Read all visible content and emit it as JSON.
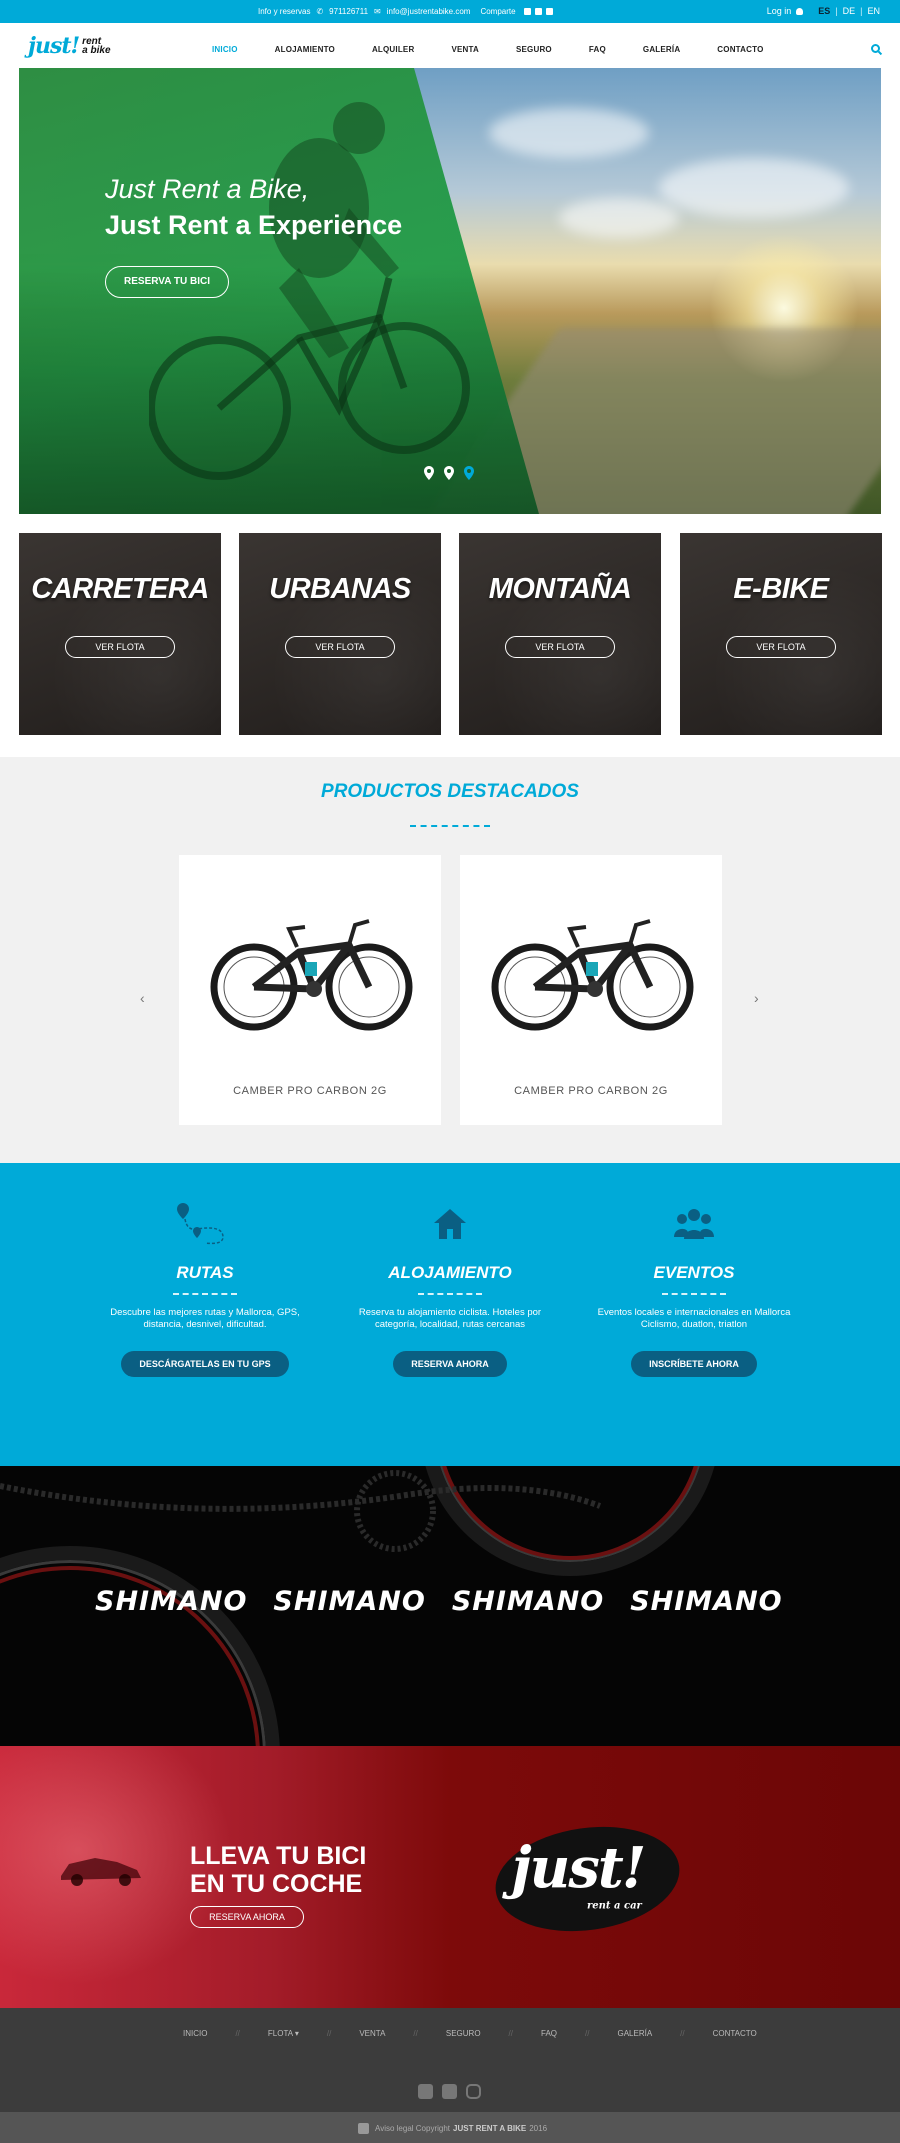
{
  "topbar": {
    "info_label": "Info y reservas",
    "phone": "971126711",
    "email": "info@justrentabike.com",
    "share_label": "Comparte",
    "login": "Log in",
    "languages": [
      "ES",
      "DE",
      "EN"
    ],
    "active_language": "ES"
  },
  "header": {
    "logo_just": "just!",
    "logo_line1": "rent",
    "logo_line2": "a bike",
    "nav": [
      {
        "label": "INICIO",
        "active": true
      },
      {
        "label": "ALOJAMIENTO",
        "active": false
      },
      {
        "label": "ALQUILER",
        "active": false
      },
      {
        "label": "VENTA",
        "active": false
      },
      {
        "label": "SEGURO",
        "active": false
      },
      {
        "label": "FAQ",
        "active": false
      },
      {
        "label": "GALERÍA",
        "active": false
      },
      {
        "label": "CONTACTO",
        "active": false
      }
    ]
  },
  "hero": {
    "line1": "Just Rent a Bike,",
    "line2": "Just Rent a Experience",
    "cta": "RESERVA TU BICI",
    "slides": 3,
    "active_slide": 3
  },
  "categories": [
    {
      "name": "CARRETERA",
      "button": "VER FLOTA"
    },
    {
      "name": "URBANAS",
      "button": "VER FLOTA"
    },
    {
      "name": "MONTAÑA",
      "button": "VER FLOTA"
    },
    {
      "name": "E-BIKE",
      "button": "VER FLOTA"
    }
  ],
  "featured": {
    "title": "PRODUCTOS DESTACADOS",
    "prev": "‹",
    "next": "›",
    "products": [
      {
        "name": "CAMBER PRO CARBON 2G"
      },
      {
        "name": "CAMBER PRO CARBON 2G"
      }
    ]
  },
  "services": [
    {
      "icon": "route-map-icon",
      "title": "RUTAS",
      "text": "Descubre las mejores rutas y Mallorca, GPS, distancia, desnivel, dificultad.",
      "button": "DESCÁRGATELAS EN TU GPS"
    },
    {
      "icon": "house-icon",
      "title": "ALOJAMIENTO",
      "text": "Reserva tu alojamiento ciclista. Hoteles por categoría, localidad, rutas cercanas",
      "button": "RESERVA AHORA"
    },
    {
      "icon": "group-icon",
      "title": "EVENTOS",
      "text": "Eventos locales e internacionales en Mallorca Ciclismo, duatlon, triatlon",
      "button": "INSCRÍBETE AHORA"
    }
  ],
  "sponsors": [
    "SHIMANO",
    "SHIMANO",
    "SHIMANO",
    "SHIMANO"
  ],
  "car_promo": {
    "line1": "LLEVA TU BICI",
    "line2": "EN TU COCHE",
    "cta": "RESERVA AHORA",
    "logo_just": "just!",
    "logo_sub": "rent a car"
  },
  "footer": {
    "nav": [
      "INICIO",
      "FLOTA ▾",
      "VENTA",
      "SEGURO",
      "FAQ",
      "GALERÍA",
      "CONTACTO"
    ],
    "social": [
      "facebook-icon",
      "twitter-icon",
      "instagram-icon"
    ],
    "legal": "Aviso legal Copyright",
    "brand": "JUST RENT A BIKE",
    "year": "2016"
  },
  "colors": {
    "brand_blue": "#00aad8",
    "dark_button": "#0a5f83",
    "promo_red": "#a31c29",
    "footer": "#3c3c3c"
  }
}
